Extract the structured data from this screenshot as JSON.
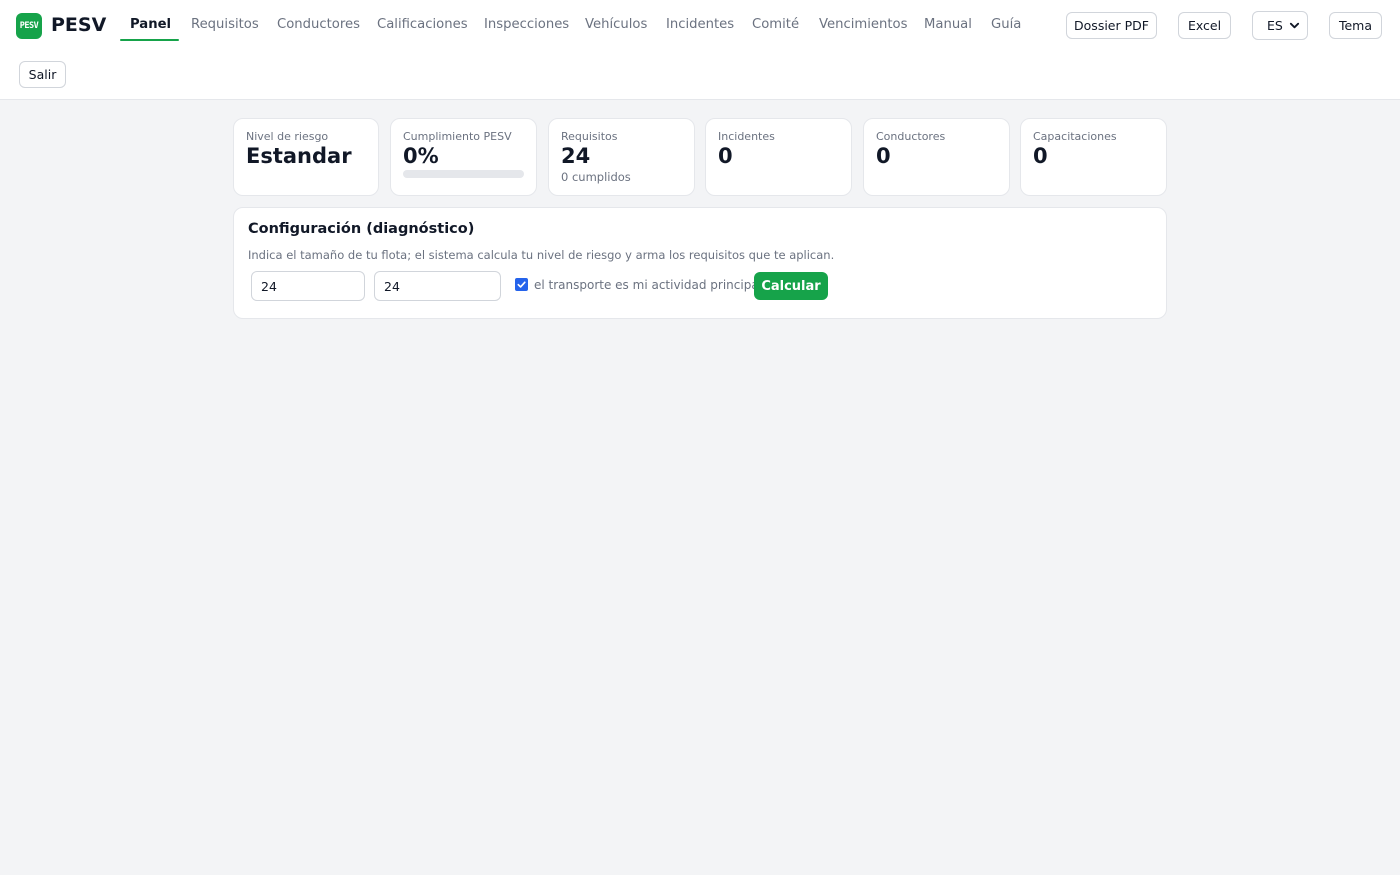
{
  "brand": {
    "logo_text": "PESV",
    "name": "PESV",
    "accent": "#16a34a"
  },
  "nav": {
    "items": [
      {
        "label": "Panel",
        "active": true
      },
      {
        "label": "Requisitos"
      },
      {
        "label": "Conductores"
      },
      {
        "label": "Calificaciones"
      },
      {
        "label": "Inspecciones"
      },
      {
        "label": "Vehículos"
      },
      {
        "label": "Incidentes"
      },
      {
        "label": "Comité"
      },
      {
        "label": "Vencimientos"
      },
      {
        "label": "Manual"
      },
      {
        "label": "Guía"
      }
    ]
  },
  "actions": {
    "dossier": "Dossier PDF",
    "excel": "Excel",
    "language": "ES",
    "theme": "Tema",
    "logout": "Salir"
  },
  "stats": {
    "risk": {
      "label": "Nivel de riesgo",
      "value": "Estandar"
    },
    "compliance": {
      "label": "Cumplimiento PESV",
      "value": "0%",
      "progress": 0
    },
    "requirements": {
      "label": "Requisitos",
      "value": "24",
      "sub": "0 cumplidos"
    },
    "incidents": {
      "label": "Incidentes",
      "value": "0"
    },
    "drivers": {
      "label": "Conductores",
      "value": "0"
    },
    "trainings": {
      "label": "Capacitaciones",
      "value": "0"
    }
  },
  "config": {
    "title": "Configuración (diagnóstico)",
    "description": "Indica el tamaño de tu flota; el sistema calcula tu nivel de riesgo y arma los requisitos que te aplican.",
    "field1_value": "24",
    "field2_value": "24",
    "checkbox_label": "el transporte es mi actividad principal",
    "checkbox_checked": true,
    "calculate": "Calcular"
  }
}
